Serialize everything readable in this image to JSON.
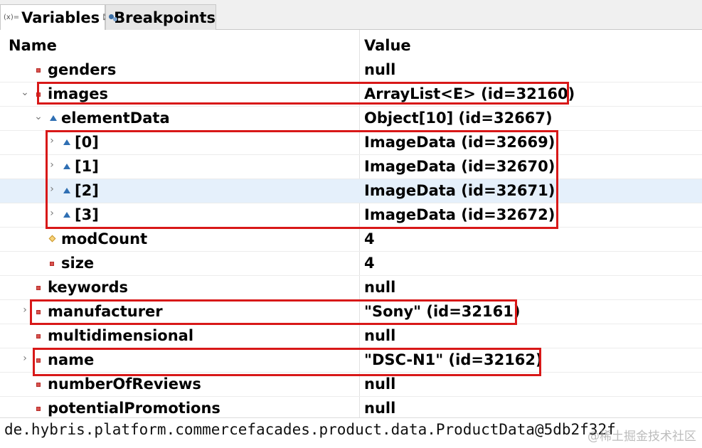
{
  "tabs": [
    {
      "icon": "variables-icon",
      "icon_text": "(x)=",
      "label": "Variables",
      "close": "⊠",
      "active": true
    },
    {
      "icon": "breakpoints-icon",
      "label": "Breakpoints",
      "active": false
    }
  ],
  "columns": {
    "name": "Name",
    "value": "Value"
  },
  "rows": [
    {
      "name": "genders",
      "value": "null",
      "icon": "field-private-icon",
      "expander": ""
    },
    {
      "name": "images",
      "value": "ArrayList<E>  (id=32160)",
      "icon": "field-private-icon",
      "expander": "⌄"
    },
    {
      "name": "elementData",
      "value": "Object[10]  (id=32667)",
      "icon": "field-package-icon",
      "expander": "⌄"
    },
    {
      "name": "[0]",
      "value": "ImageData  (id=32669)",
      "icon": "field-package-icon",
      "expander": "›"
    },
    {
      "name": "[1]",
      "value": "ImageData  (id=32670)",
      "icon": "field-package-icon",
      "expander": "›"
    },
    {
      "name": "[2]",
      "value": "ImageData  (id=32671)",
      "icon": "field-package-icon",
      "expander": "›"
    },
    {
      "name": "[3]",
      "value": "ImageData  (id=32672)",
      "icon": "field-package-icon",
      "expander": "›"
    },
    {
      "name": "modCount",
      "value": "4",
      "icon": "field-protected-icon",
      "expander": ""
    },
    {
      "name": "size",
      "value": "4",
      "icon": "field-private-icon",
      "expander": ""
    },
    {
      "name": "keywords",
      "value": "null",
      "icon": "field-private-icon",
      "expander": ""
    },
    {
      "name": "manufacturer",
      "value": "\"Sony\" (id=32161)",
      "icon": "field-private-icon",
      "expander": "›"
    },
    {
      "name": "multidimensional",
      "value": "null",
      "icon": "field-private-icon",
      "expander": ""
    },
    {
      "name": "name",
      "value": "\"DSC-N1\" (id=32162)",
      "icon": "field-private-icon",
      "expander": "›"
    },
    {
      "name": "numberOfReviews",
      "value": "null",
      "icon": "field-private-icon",
      "expander": ""
    },
    {
      "name": "potentialPromotions",
      "value": "null",
      "icon": "field-private-icon",
      "expander": ""
    }
  ],
  "selected_row": "[2]",
  "detail_text": "de.hybris.platform.commercefacades.product.data.ProductData@5db2f32f",
  "watermark": "@稀土掘金技术社区",
  "colors": {
    "highlight": "#d81818",
    "selection": "#e5f0fb",
    "private_field": "#d9534f",
    "package_field": "#2f6fb3",
    "protected_field": "#f7d27a"
  }
}
